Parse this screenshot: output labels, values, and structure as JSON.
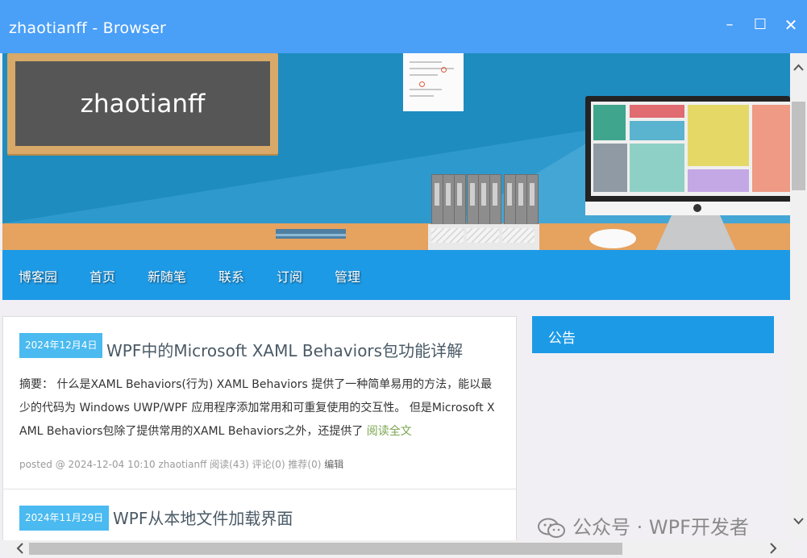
{
  "window": {
    "title": "zhaotianff - Browser",
    "controls": {
      "minimize": "–",
      "maximize": "☐",
      "close": "✕"
    }
  },
  "banner": {
    "chalkboard_text": "zhaotianff"
  },
  "nav": {
    "items": [
      "博客园",
      "首页",
      "新随笔",
      "联系",
      "订阅",
      "管理"
    ]
  },
  "posts": [
    {
      "date": "2024年12月4日",
      "title": "WPF中的Microsoft XAML Behaviors包功能详解",
      "summary": "摘要： 什么是XAML Behaviors(行为) XAML Behaviors 提供了一种简单易用的方法，能以最少的代码为 Windows UWP/WPF 应用程序添加常用和可重复使用的交互性。 但是Microsoft XAML Behaviors包除了提供常用的XAML Behaviors之外，还提供了",
      "read_more": "阅读全文",
      "meta": "posted @ 2024-12-04 10:10 zhaotianff 阅读(43) 评论(0) 推荐(0)",
      "edit": "编辑"
    },
    {
      "date": "2024年11月29日",
      "title": "WPF从本地文件加载界面"
    }
  ],
  "sidebar": {
    "notice_title": "公告"
  },
  "watermark": "公众号 · WPF开发者",
  "colors": {
    "titlebar": "#4a9ff7",
    "nav": "#1d9ae6",
    "badge": "#4abaf0",
    "banner": "#1f8cc0"
  }
}
